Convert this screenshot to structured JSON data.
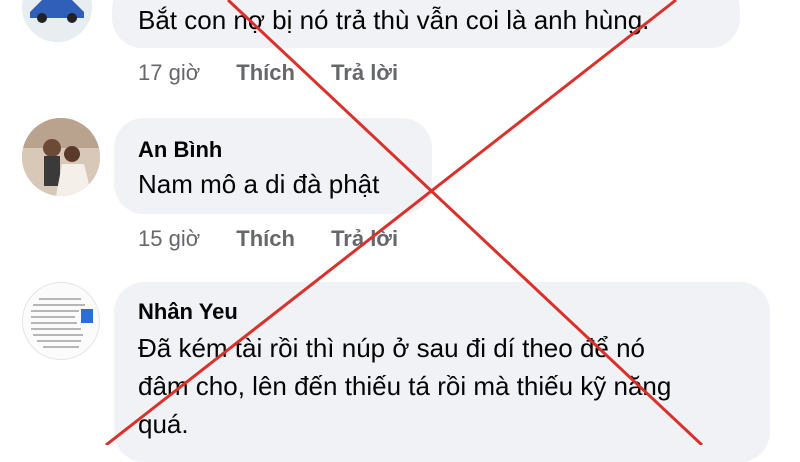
{
  "comments": [
    {
      "author": "",
      "text": "Bắt con nợ bị nó trả thù vẫn coi là anh hùng.",
      "time": "17 giờ",
      "like": "Thích",
      "reply": "Trả lời"
    },
    {
      "author": "An Bình",
      "text": "Nam mô a di đà phật",
      "time": "15 giờ",
      "like": "Thích",
      "reply": "Trả lời"
    },
    {
      "author": "Nhân Yeu",
      "text_line1": "Đã kém tài rồi thì núp ở sau đi dí theo để nó",
      "text_line2": "đâm cho, lên đến thiếu tá rồi mà thiếu kỹ năng",
      "text_line3": "quá."
    }
  ],
  "colors": {
    "bubble": "#f0f2f5",
    "meta": "#65676b",
    "cross": "#d9312b"
  }
}
